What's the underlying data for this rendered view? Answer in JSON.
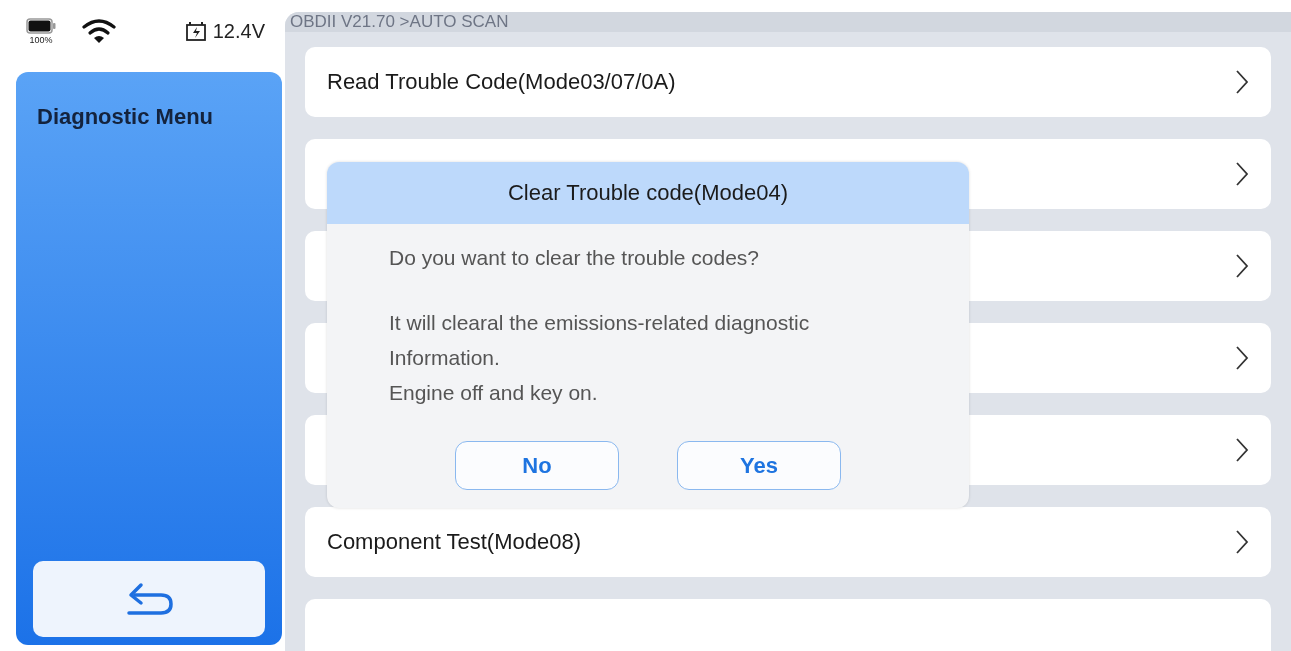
{
  "status_bar": {
    "battery_percent": "100%",
    "voltage": "12.4V"
  },
  "breadcrumb": "OBDII V21.70 >AUTO SCAN",
  "sidebar": {
    "title": "Diagnostic Menu"
  },
  "menu_rows": [
    {
      "kind": "item",
      "label": "Read Trouble Code(Mode03/07/0A)"
    },
    {
      "kind": "item"
    },
    {
      "kind": "item"
    },
    {
      "kind": "item"
    },
    {
      "kind": "item"
    },
    {
      "kind": "item",
      "label": "Component Test(Mode08)"
    },
    {
      "kind": "peek"
    }
  ],
  "dialog": {
    "title": "Clear Trouble code(Mode04)",
    "paragraphs": [
      [
        "Do you want to clear the trouble codes?"
      ],
      [
        "It will clearal the emissions-related diagnostic",
        "Information.",
        "Engine off and key on."
      ]
    ],
    "buttons": [
      "No",
      "Yes"
    ]
  }
}
